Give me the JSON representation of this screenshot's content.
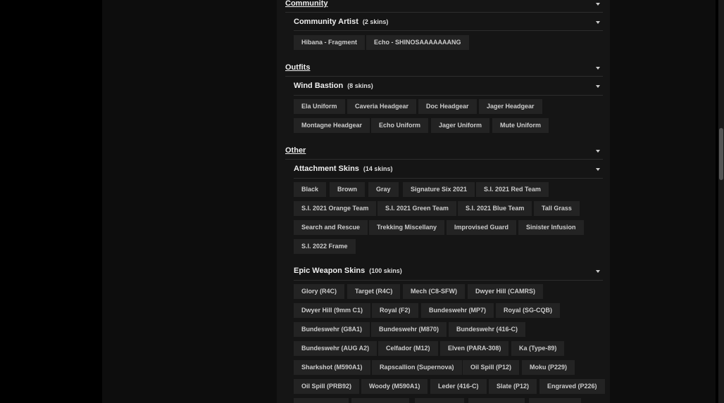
{
  "categories": {
    "community": "Community",
    "outfits": "Outfits",
    "other": "Other"
  },
  "subsections": {
    "community_artist": {
      "title": "Community Artist",
      "count": "(2 skins)"
    },
    "wind_bastion": {
      "title": "Wind Bastion",
      "count": "(8 skins)"
    },
    "attachment_skins": {
      "title": "Attachment Skins",
      "count": "(14 skins)"
    },
    "epic_weapon_skins": {
      "title": "Epic Weapon Skins",
      "count": "(100 skins)"
    }
  },
  "items": {
    "community_artist": [
      "Hibana - Fragment",
      "Echo - SHINOSAAAAAAANG"
    ],
    "wind_bastion": [
      "Ela Uniform",
      "Caveria Headgear",
      "Doc Headgear",
      "Jager Headgear",
      "Montagne Headgear",
      "Echo Uniform",
      "Jager Uniform",
      "Mute Uniform"
    ],
    "attachment_skins": [
      "Black",
      "Brown",
      "Gray",
      "Signature Six 2021",
      "S.I. 2021 Red Team",
      "S.I. 2021 Orange Team",
      "S.I. 2021 Green Team",
      "S.I. 2021 Blue Team",
      "Tall Grass",
      "Search and Rescue",
      "Trekking Miscellany",
      "Improvised Guard",
      "Sinister Infusion",
      "S.I. 2022 Frame"
    ],
    "epic_weapon_skins": [
      "Glory (R4C)",
      "Target (R4C)",
      "Mech (C8-SFW)",
      "Dwyer Hill (CAMRS)",
      "Dwyer Hill (9mm C1)",
      "Royal (F2)",
      "Bundeswehr (MP7)",
      "Royal (SG-CQB)",
      "Bundeswehr (G8A1)",
      "Bundeswehr (M870)",
      "Bundeswehr (416-C)",
      "Bundeswehr (AUG A2)",
      "Celfador (M12)",
      "Elven (PARA-308)",
      "Ka (Type-89)",
      "Sharkshot (M590A1)",
      "Rapscallion (Supernova)",
      "Oil Spill (P12)",
      "Moku (P229)",
      "Oil Spill (PRB92)",
      "Woody (M590A1)",
      "Leder (416-C)",
      "Slate (P12)",
      "Engraved (P226)"
    ]
  }
}
